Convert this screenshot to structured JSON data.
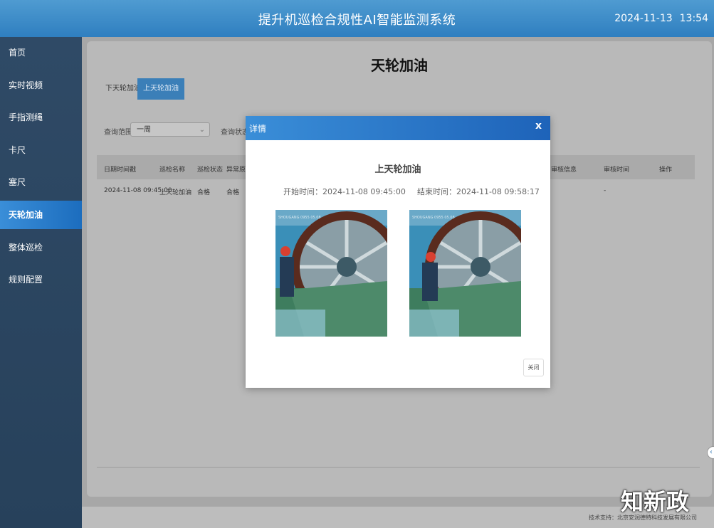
{
  "header": {
    "title": "提升机巡检合规性AI智能监测系统",
    "date": "2024-11-13",
    "time": "13:54"
  },
  "sidebar": {
    "items": [
      {
        "label": "首页"
      },
      {
        "label": "实时视频"
      },
      {
        "label": "手指测绳"
      },
      {
        "label": "卡尺"
      },
      {
        "label": "塞尺"
      },
      {
        "label": "天轮加油"
      },
      {
        "label": "整体巡检"
      },
      {
        "label": "规则配置"
      }
    ],
    "active_index": 5
  },
  "page": {
    "title": "天轮加油",
    "tabs": [
      {
        "label": "下天轮加油"
      },
      {
        "label": "上天轮加油"
      }
    ],
    "active_tab": 1
  },
  "filters": {
    "range_label": "查询范围",
    "range_value": "一周",
    "status_label": "查询状态"
  },
  "table": {
    "columns": [
      "日期时间戳",
      "巡检名称",
      "巡检状态",
      "异常原因",
      "审核信息",
      "审核时间",
      "操作"
    ],
    "rows": [
      {
        "datetime": "2024-11-08 09:45:00",
        "name": "上天轮加油",
        "status": "合格",
        "reason": "合格",
        "audit_time": "-"
      }
    ]
  },
  "modal": {
    "title": "详情",
    "close_x": "x",
    "subtitle": "上天轮加油",
    "start_label": "开始时间：2024-11-08 09:45:00",
    "end_label": "结束时间：2024-11-08 09:58:17",
    "photo_caption": "SHOUGANG 0955 05.08",
    "close_button": "关闭"
  },
  "footer": {
    "support": "技术支持：北京安润德特科技发展有限公司"
  },
  "watermark": "知新政",
  "colors": {
    "header_blue": "#2f7fc0",
    "sidebar": "#2f4a66",
    "active": "#1c6dbe"
  }
}
